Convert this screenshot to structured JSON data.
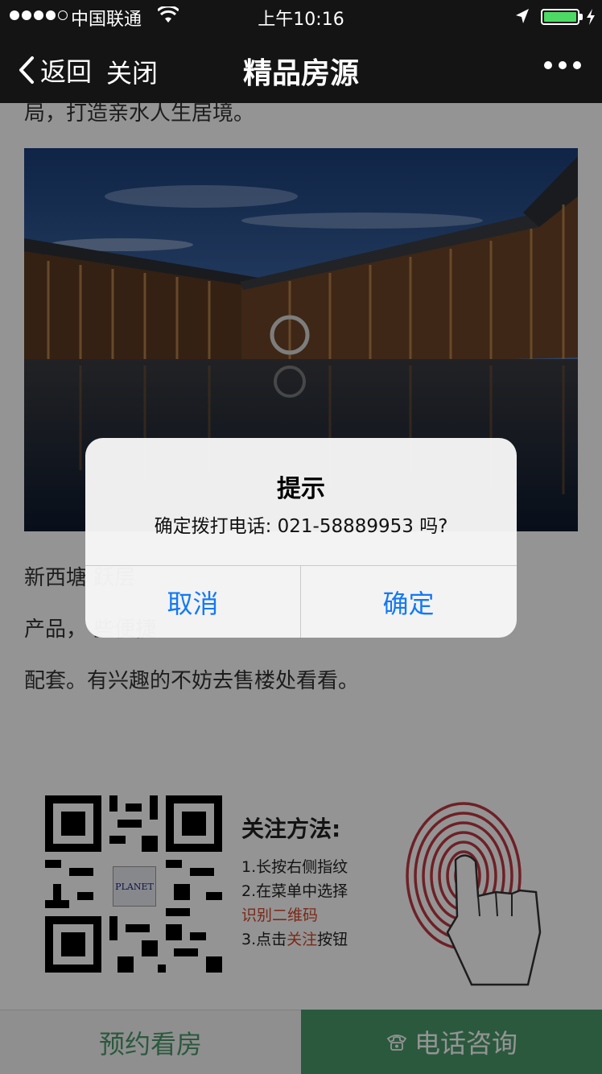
{
  "status_bar": {
    "carrier": "中国联通",
    "time": "上午10:16"
  },
  "nav": {
    "back_label": "返回",
    "close_label": "关闭",
    "title": "精品房源"
  },
  "content": {
    "intro_tail": "局，打造亲水人生居境。",
    "desc_lines": [
      "新西塘                                            跃层",
      "产品，                                            些便捷",
      "配套。有兴趣的不妨去售楼处看看。"
    ],
    "qr_logo": "PLANET",
    "howto": {
      "title": "关注方法:",
      "step1": "1.长按右侧指纹",
      "step2": "2.在菜单中选择",
      "step2b": "识别二维码",
      "step3_a": "3.点击",
      "step3_b": "关注",
      "step3_c": "按钮"
    }
  },
  "bottom_bar": {
    "book_label": "预约看房",
    "call_label": "电话咨询"
  },
  "alert": {
    "title": "提示",
    "message": "确定拨打电话: 021-58889953 吗?",
    "cancel_label": "取消",
    "ok_label": "确定"
  },
  "colors": {
    "nav_bg": "#141414",
    "accent_green": "#4a9a6c",
    "ios_blue": "#1479f5",
    "battery_green": "#4cd964"
  }
}
